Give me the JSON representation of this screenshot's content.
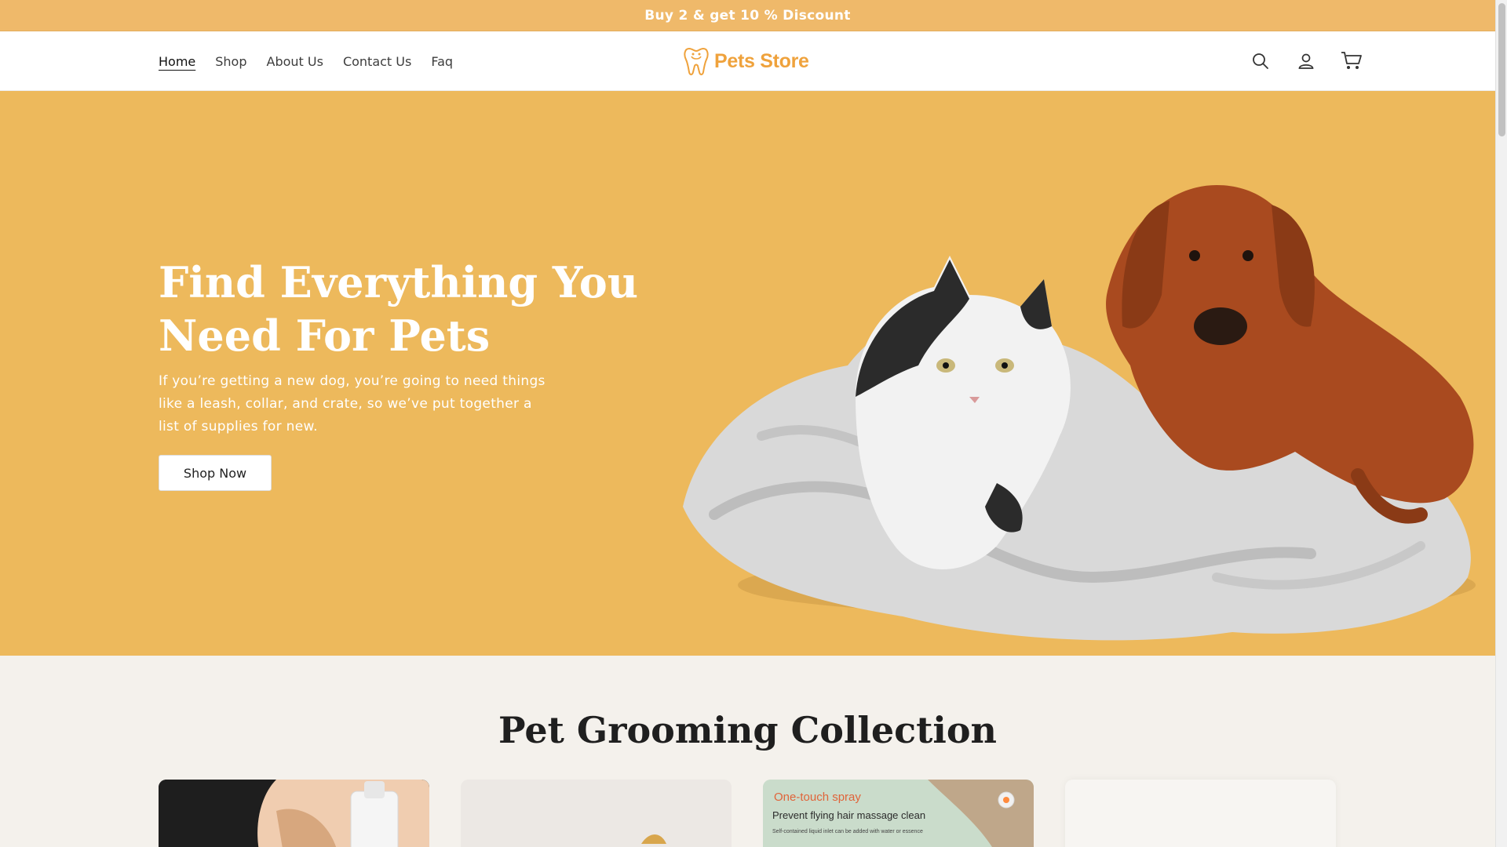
{
  "announcement": {
    "text": "Buy 2 & get 10 % Discount"
  },
  "header": {
    "nav": [
      {
        "label": "Home",
        "active": true
      },
      {
        "label": "Shop"
      },
      {
        "label": "About Us"
      },
      {
        "label": "Contact Us"
      },
      {
        "label": "Faq"
      }
    ],
    "logo_text": "Pets Store",
    "icons": [
      "search-icon",
      "account-icon",
      "cart-icon"
    ]
  },
  "hero": {
    "title": "Find Everything You Need For Pets",
    "text": "If you’re getting a new dog, you’re going to need things like a leash, collar, and crate, so we’ve put together a list of supplies for new.",
    "button_label": "Shop Now"
  },
  "collection": {
    "title": "Pet Grooming Collection",
    "card3": {
      "line1": "One-touch spray",
      "line2": "Prevent flying hair massage clean",
      "line3": "Self-contained liquid inlet can be added with water or essence"
    }
  },
  "colors": {
    "announcement_bg": "#EFB96A",
    "hero_bg": "#EDB95C",
    "logo": "#EFA23C",
    "collection_bg": "#F4F1EC"
  }
}
